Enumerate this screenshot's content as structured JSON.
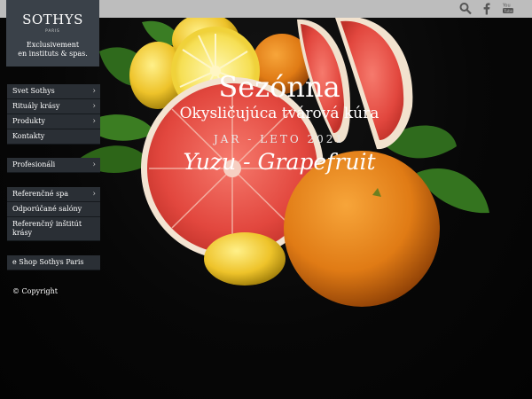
{
  "brand": {
    "logo_text": "SOTHYS",
    "logo_sub": "PARIS",
    "tagline_line1": "Exclusivement",
    "tagline_line2": "en instituts & spas."
  },
  "topbar": {
    "icons": [
      "search-icon",
      "facebook-icon",
      "youtube-icon"
    ],
    "background": "#bdbdbd"
  },
  "menu": {
    "group1": [
      {
        "label": "Svet Sothys",
        "chevron": "›"
      },
      {
        "label": "Rituály krásy",
        "chevron": "›"
      },
      {
        "label": "Produkty",
        "chevron": "›"
      },
      {
        "label": "Kontakty",
        "chevron": ""
      }
    ],
    "group2": [
      {
        "label": "Profesionáli",
        "chevron": "›"
      }
    ],
    "group3": [
      {
        "label": "Referenčné spa",
        "chevron": "›"
      },
      {
        "label": "Odporúčané salóny",
        "chevron": ""
      },
      {
        "label": "Referenčný inštitút krásy",
        "chevron": ""
      }
    ],
    "group4": [
      {
        "label": "e Shop Sothys Paris",
        "chevron": ""
      }
    ],
    "background": "#2a2f35"
  },
  "copyright": "© Copyright",
  "hero": {
    "title": "Sezónna",
    "subtitle": "Okysličujúca tvárová kúra",
    "season": "JAR - LETO 2021",
    "product": "Yuzu - Grapefruit"
  }
}
